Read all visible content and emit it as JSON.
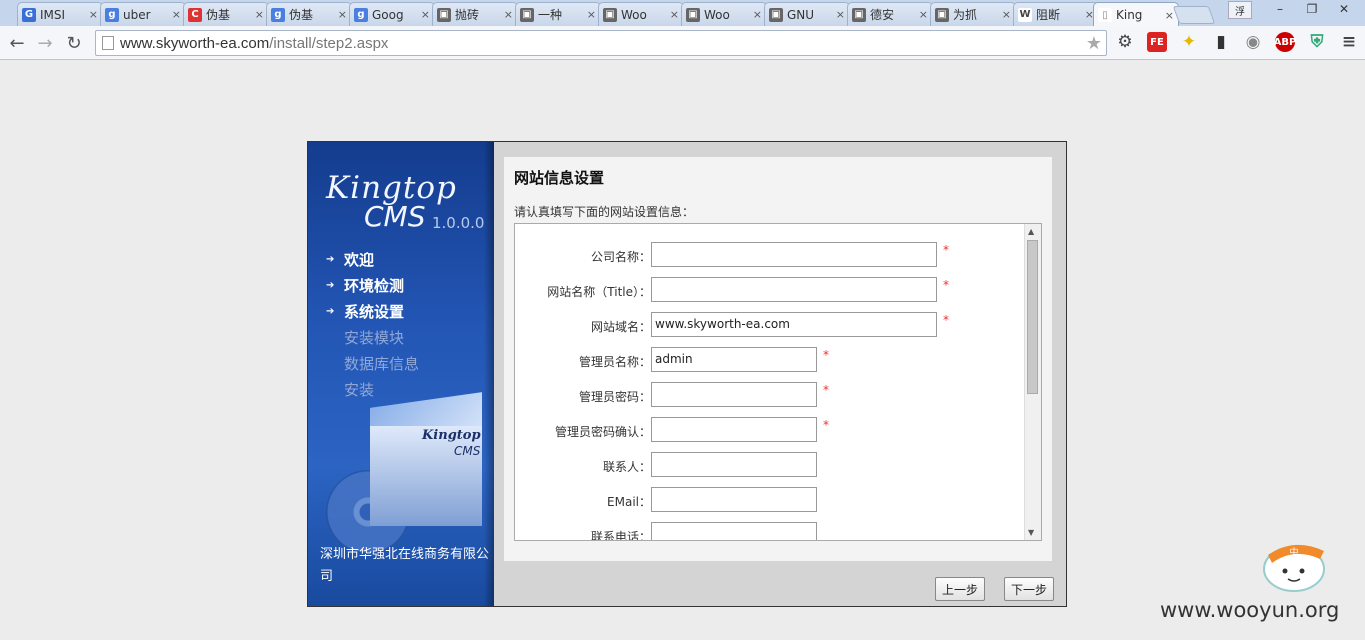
{
  "browser": {
    "tabs": [
      {
        "title": "IMSI",
        "icon": "g-circle",
        "color": "#3a6fd6"
      },
      {
        "title": "uber",
        "icon": "google-g",
        "color": "#4a7fe0"
      },
      {
        "title": "伪基",
        "icon": "c-logo",
        "color": "#d33"
      },
      {
        "title": "伪基",
        "icon": "google-g",
        "color": "#4a7fe0"
      },
      {
        "title": "Goog",
        "icon": "google-g",
        "color": "#4a7fe0"
      },
      {
        "title": "抛砖",
        "icon": "page",
        "color": "#666"
      },
      {
        "title": "一种",
        "icon": "page",
        "color": "#666"
      },
      {
        "title": "Woo",
        "icon": "page",
        "color": "#666"
      },
      {
        "title": "Woo",
        "icon": "page",
        "color": "#666"
      },
      {
        "title": "GNU",
        "icon": "page",
        "color": "#666"
      },
      {
        "title": "德安",
        "icon": "page",
        "color": "#666"
      },
      {
        "title": "为抓",
        "icon": "page",
        "color": "#666"
      },
      {
        "title": "阻断",
        "icon": "wikipedia-w",
        "color": "#444"
      },
      {
        "title": "King",
        "icon": "document",
        "color": "#888"
      }
    ],
    "tab_close": "×",
    "user_badge": "浮",
    "window_buttons": [
      "–",
      "❐",
      "✕"
    ],
    "url_host": "www.skyworth-ea.com",
    "url_path": "/install/step2.aspx",
    "extensions": [
      {
        "name": "gear-icon",
        "label": "⚙",
        "color": "#444"
      },
      {
        "name": "fe-icon",
        "label": "FE",
        "color": "#d22"
      },
      {
        "name": "puzzle-icon",
        "label": "✦",
        "color": "#e6b800"
      },
      {
        "name": "battery-icon",
        "label": "▮",
        "color": "#333"
      },
      {
        "name": "globe-icon",
        "label": "◉",
        "color": "#888"
      },
      {
        "name": "abp-icon",
        "label": "ABP",
        "color": "#c00"
      },
      {
        "name": "shield-icon",
        "label": "⛨",
        "color": "#3a7"
      },
      {
        "name": "menu-icon",
        "label": "≡",
        "color": "#444"
      }
    ]
  },
  "installer": {
    "brand": "Kingtop",
    "brand_sub": "CMS",
    "version": "1.0.0.0",
    "steps": [
      {
        "label": "欢迎",
        "state": "done"
      },
      {
        "label": "环境检测",
        "state": "done"
      },
      {
        "label": "系统设置",
        "state": "done"
      },
      {
        "label": "安装模块",
        "state": "pending"
      },
      {
        "label": "数据库信息",
        "state": "pending"
      },
      {
        "label": "安装",
        "state": "pending"
      }
    ],
    "box_logo": "Kingtop",
    "box_logo_sub": "CMS",
    "company": "深圳市华强北在线商务有限公司",
    "panel_title": "网站信息设置",
    "panel_desc": "请认真填写下面的网站设置信息：",
    "fields": [
      {
        "label": "公司名称：",
        "value": "",
        "size": "long",
        "required": true
      },
      {
        "label": "网站名称（Title）：",
        "value": "",
        "size": "long",
        "required": true
      },
      {
        "label": "网站域名：",
        "value": "www.skyworth-ea.com",
        "size": "long",
        "required": true
      },
      {
        "label": "管理员名称：",
        "value": "admin",
        "size": "short",
        "required": true
      },
      {
        "label": "管理员密码：",
        "value": "",
        "size": "short",
        "required": true
      },
      {
        "label": "管理员密码确认：",
        "value": "",
        "size": "short",
        "required": true
      },
      {
        "label": "联系人：",
        "value": "",
        "size": "short",
        "required": false
      },
      {
        "label": "EMail：",
        "value": "",
        "size": "short",
        "required": false
      },
      {
        "label": "联系电话：",
        "value": "",
        "size": "short",
        "required": false
      }
    ],
    "required_mark": "*",
    "prev_button": "上一步",
    "next_button": "下一步"
  },
  "watermark": {
    "text": "www.wooyun.org",
    "mascot_label": "中"
  }
}
